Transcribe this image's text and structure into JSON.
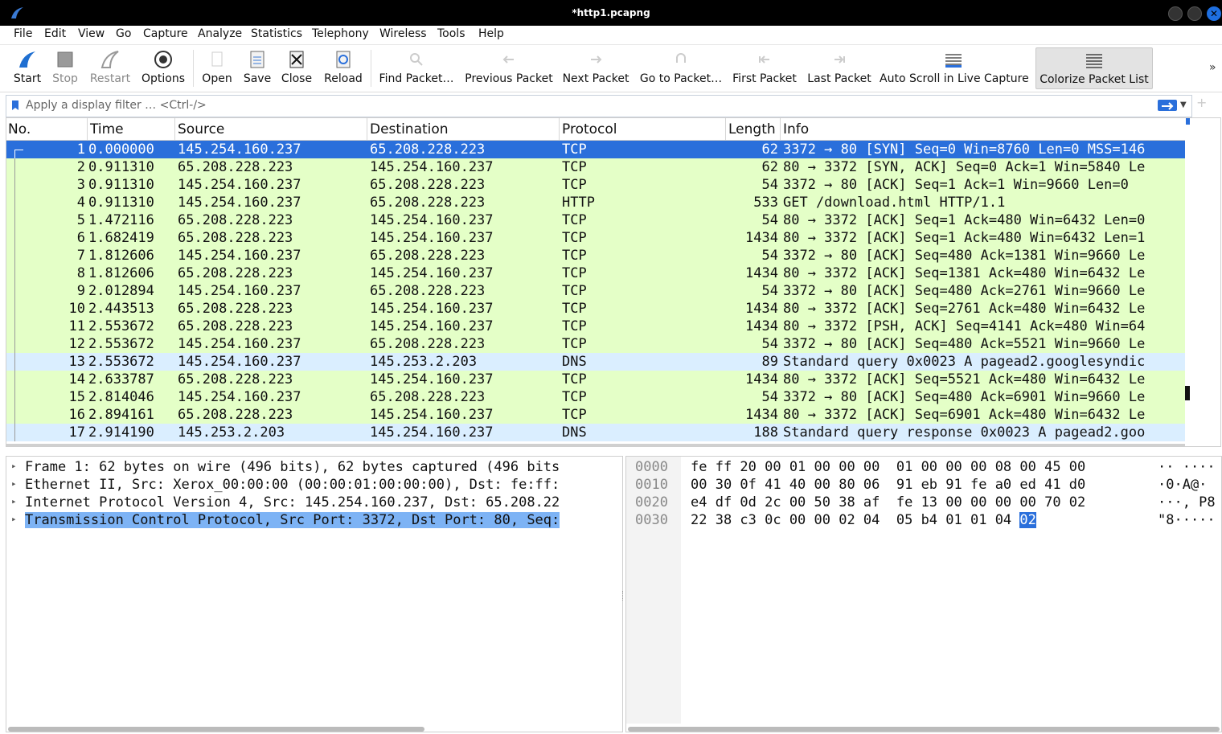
{
  "window": {
    "title": "*http1.pcapng"
  },
  "menu": [
    "File",
    "Edit",
    "View",
    "Go",
    "Capture",
    "Analyze",
    "Statistics",
    "Telephony",
    "Wireless",
    "Tools",
    "Help"
  ],
  "toolbar": {
    "start": "Start",
    "stop": "Stop",
    "restart": "Restart",
    "options": "Options",
    "open": "Open",
    "save": "Save",
    "close": "Close",
    "reload": "Reload",
    "find": "Find Packet…",
    "prev": "Previous Packet",
    "next": "Next Packet",
    "goto": "Go to Packet…",
    "first": "First Packet",
    "last": "Last Packet",
    "autoscroll": "Auto Scroll in Live Capture",
    "colorize": "Colorize Packet List",
    "more": "»"
  },
  "filter": {
    "placeholder": "Apply a display filter … <Ctrl-/>"
  },
  "columns": {
    "no": "No.",
    "time": "Time",
    "source": "Source",
    "destination": "Destination",
    "protocol": "Protocol",
    "length": "Length",
    "info": "Info"
  },
  "packets": [
    {
      "no": "1",
      "time": "0.000000",
      "src": "145.254.160.237",
      "dst": "65.208.228.223",
      "proto": "TCP",
      "len": "62",
      "info": "3372 → 80 [SYN] Seq=0 Win=8760 Len=0 MSS=146"
    },
    {
      "no": "2",
      "time": "0.911310",
      "src": "65.208.228.223",
      "dst": "145.254.160.237",
      "proto": "TCP",
      "len": "62",
      "info": "80 → 3372 [SYN, ACK] Seq=0 Ack=1 Win=5840 Le"
    },
    {
      "no": "3",
      "time": "0.911310",
      "src": "145.254.160.237",
      "dst": "65.208.228.223",
      "proto": "TCP",
      "len": "54",
      "info": "3372 → 80 [ACK] Seq=1 Ack=1 Win=9660 Len=0"
    },
    {
      "no": "4",
      "time": "0.911310",
      "src": "145.254.160.237",
      "dst": "65.208.228.223",
      "proto": "HTTP",
      "len": "533",
      "info": "GET /download.html HTTP/1.1"
    },
    {
      "no": "5",
      "time": "1.472116",
      "src": "65.208.228.223",
      "dst": "145.254.160.237",
      "proto": "TCP",
      "len": "54",
      "info": "80 → 3372 [ACK] Seq=1 Ack=480 Win=6432 Len=0"
    },
    {
      "no": "6",
      "time": "1.682419",
      "src": "65.208.228.223",
      "dst": "145.254.160.237",
      "proto": "TCP",
      "len": "1434",
      "info": "80 → 3372 [ACK] Seq=1 Ack=480 Win=6432 Len=1"
    },
    {
      "no": "7",
      "time": "1.812606",
      "src": "145.254.160.237",
      "dst": "65.208.228.223",
      "proto": "TCP",
      "len": "54",
      "info": "3372 → 80 [ACK] Seq=480 Ack=1381 Win=9660 Le"
    },
    {
      "no": "8",
      "time": "1.812606",
      "src": "65.208.228.223",
      "dst": "145.254.160.237",
      "proto": "TCP",
      "len": "1434",
      "info": "80 → 3372 [ACK] Seq=1381 Ack=480 Win=6432 Le"
    },
    {
      "no": "9",
      "time": "2.012894",
      "src": "145.254.160.237",
      "dst": "65.208.228.223",
      "proto": "TCP",
      "len": "54",
      "info": "3372 → 80 [ACK] Seq=480 Ack=2761 Win=9660 Le"
    },
    {
      "no": "10",
      "time": "2.443513",
      "src": "65.208.228.223",
      "dst": "145.254.160.237",
      "proto": "TCP",
      "len": "1434",
      "info": "80 → 3372 [ACK] Seq=2761 Ack=480 Win=6432 Le"
    },
    {
      "no": "11",
      "time": "2.553672",
      "src": "65.208.228.223",
      "dst": "145.254.160.237",
      "proto": "TCP",
      "len": "1434",
      "info": "80 → 3372 [PSH, ACK] Seq=4141 Ack=480 Win=64"
    },
    {
      "no": "12",
      "time": "2.553672",
      "src": "145.254.160.237",
      "dst": "65.208.228.223",
      "proto": "TCP",
      "len": "54",
      "info": "3372 → 80 [ACK] Seq=480 Ack=5521 Win=9660 Le"
    },
    {
      "no": "13",
      "time": "2.553672",
      "src": "145.254.160.237",
      "dst": "145.253.2.203",
      "proto": "DNS",
      "len": "89",
      "info": "Standard query 0x0023 A pagead2.googlesyndic"
    },
    {
      "no": "14",
      "time": "2.633787",
      "src": "65.208.228.223",
      "dst": "145.254.160.237",
      "proto": "TCP",
      "len": "1434",
      "info": "80 → 3372 [ACK] Seq=5521 Ack=480 Win=6432 Le"
    },
    {
      "no": "15",
      "time": "2.814046",
      "src": "145.254.160.237",
      "dst": "65.208.228.223",
      "proto": "TCP",
      "len": "54",
      "info": "3372 → 80 [ACK] Seq=480 Ack=6901 Win=9660 Le"
    },
    {
      "no": "16",
      "time": "2.894161",
      "src": "65.208.228.223",
      "dst": "145.254.160.237",
      "proto": "TCP",
      "len": "1434",
      "info": "80 → 3372 [ACK] Seq=6901 Ack=480 Win=6432 Le"
    },
    {
      "no": "17",
      "time": "2.914190",
      "src": "145.253.2.203",
      "dst": "145.254.160.237",
      "proto": "DNS",
      "len": "188",
      "info": "Standard query response 0x0023 A pagead2.goo"
    }
  ],
  "details": [
    "Frame 1: 62 bytes on wire (496 bits), 62 bytes captured (496 bits",
    "Ethernet II, Src: Xerox_00:00:00 (00:00:01:00:00:00), Dst: fe:ff:",
    "Internet Protocol Version 4, Src: 145.254.160.237, Dst: 65.208.22",
    "Transmission Control Protocol, Src Port: 3372, Dst Port: 80, Seq:"
  ],
  "bytes": {
    "offsets": [
      "0000",
      "0010",
      "0020",
      "0030"
    ],
    "hex": [
      "fe ff 20 00 01 00 00 00  01 00 00 00 08 00 45 00",
      "00 30 0f 41 40 00 80 06  91 eb 91 fe a0 ed 41 d0",
      "e4 df 0d 2c 00 50 38 af  fe 13 00 00 00 00 70 02",
      "22 38 c3 0c 00 00 02 04  05 b4 01 01 04 "
    ],
    "hex_highlight": "02",
    "ascii": [
      "·· ····",
      "·0·A@·",
      "···, P8",
      "\"8·····"
    ]
  },
  "colors": {
    "tcp": "#e4ffc7",
    "dns": "#daeeff",
    "selected": "#2a6fdb",
    "detail_selected": "#7db3f5"
  }
}
